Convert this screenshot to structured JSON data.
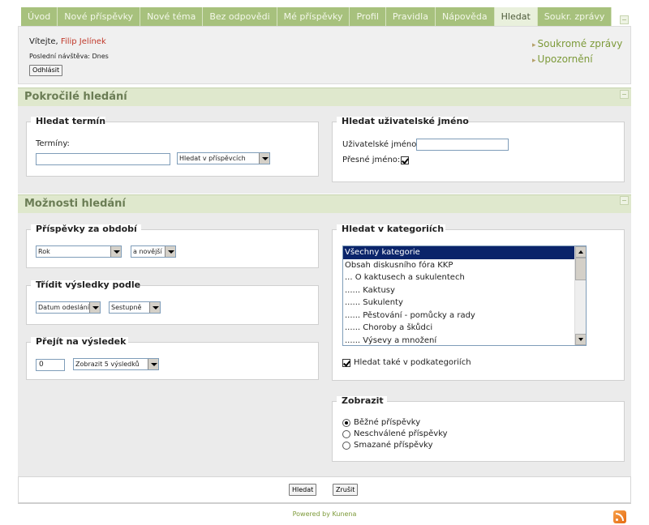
{
  "tabs": [
    {
      "label": "Úvod"
    },
    {
      "label": "Nové příspěvky"
    },
    {
      "label": "Nové téma"
    },
    {
      "label": "Bez odpovědi"
    },
    {
      "label": "Mé příspěvky"
    },
    {
      "label": "Profil"
    },
    {
      "label": "Pravidla"
    },
    {
      "label": "Nápověda"
    },
    {
      "label": "Hledat",
      "active": true
    },
    {
      "label": "Soukr. zprávy"
    }
  ],
  "welcome": {
    "greeting": "Vítejte,",
    "username": "Filip Jelínek",
    "last_visit": "Poslední návštěva: Dnes",
    "logout": "Odhlásit",
    "links": [
      "Soukromé zprávy",
      "Upozornění"
    ]
  },
  "advanced": {
    "title": "Pokročilé hledání",
    "term": {
      "legend": "Hledat termín",
      "label": "Termíny:",
      "value": "",
      "scope": "Hledat v příspěvcích"
    },
    "user": {
      "legend": "Hledat uživatelské jméno",
      "label": "Uživatelské jméno:",
      "value": "",
      "exact_label": "Přesné jméno:",
      "exact_checked": true
    }
  },
  "options": {
    "title": "Možnosti hledání",
    "period": {
      "legend": "Příspěvky za období",
      "value": "Rok",
      "direction": "a novější"
    },
    "sort": {
      "legend": "Třídit výsledky podle",
      "field": "Datum odeslání",
      "order": "Sestupně"
    },
    "jump": {
      "legend": "Přejít na výsledek",
      "start": "0",
      "limit": "Zobrazit 5 výsledků"
    },
    "categories": {
      "legend": "Hledat v kategoriích",
      "items": [
        "Všechny kategorie",
        "Obsah diskusního fóra KKP",
        "... O kaktusech a sukulentech",
        "...... Kaktusy",
        "...... Sukulenty",
        "...... Pěstování - pomůcky a rady",
        "...... Choroby a škůdci",
        "...... Výsevy a množení"
      ],
      "selected_index": 0,
      "subcats_label": "Hledat také v podkategoriích",
      "subcats_checked": true
    },
    "show": {
      "legend": "Zobrazit",
      "options": [
        "Běžné příspěvky",
        "Neschválené příspěvky",
        "Smazané příspěvky"
      ],
      "selected_index": 0
    }
  },
  "actions": {
    "search": "Hledat",
    "cancel": "Zrušit"
  },
  "footer": {
    "powered": "Powered by Kunena"
  },
  "colors": {
    "tab_bg": "#a7c17d",
    "tab_active_bg": "#e9f0dc",
    "section_bar_bg": "#dfe8cd",
    "section_title": "#6b7d55",
    "link_green": "#7d9a3a",
    "username_red": "#c0392b",
    "list_selected": "#0a246a"
  }
}
